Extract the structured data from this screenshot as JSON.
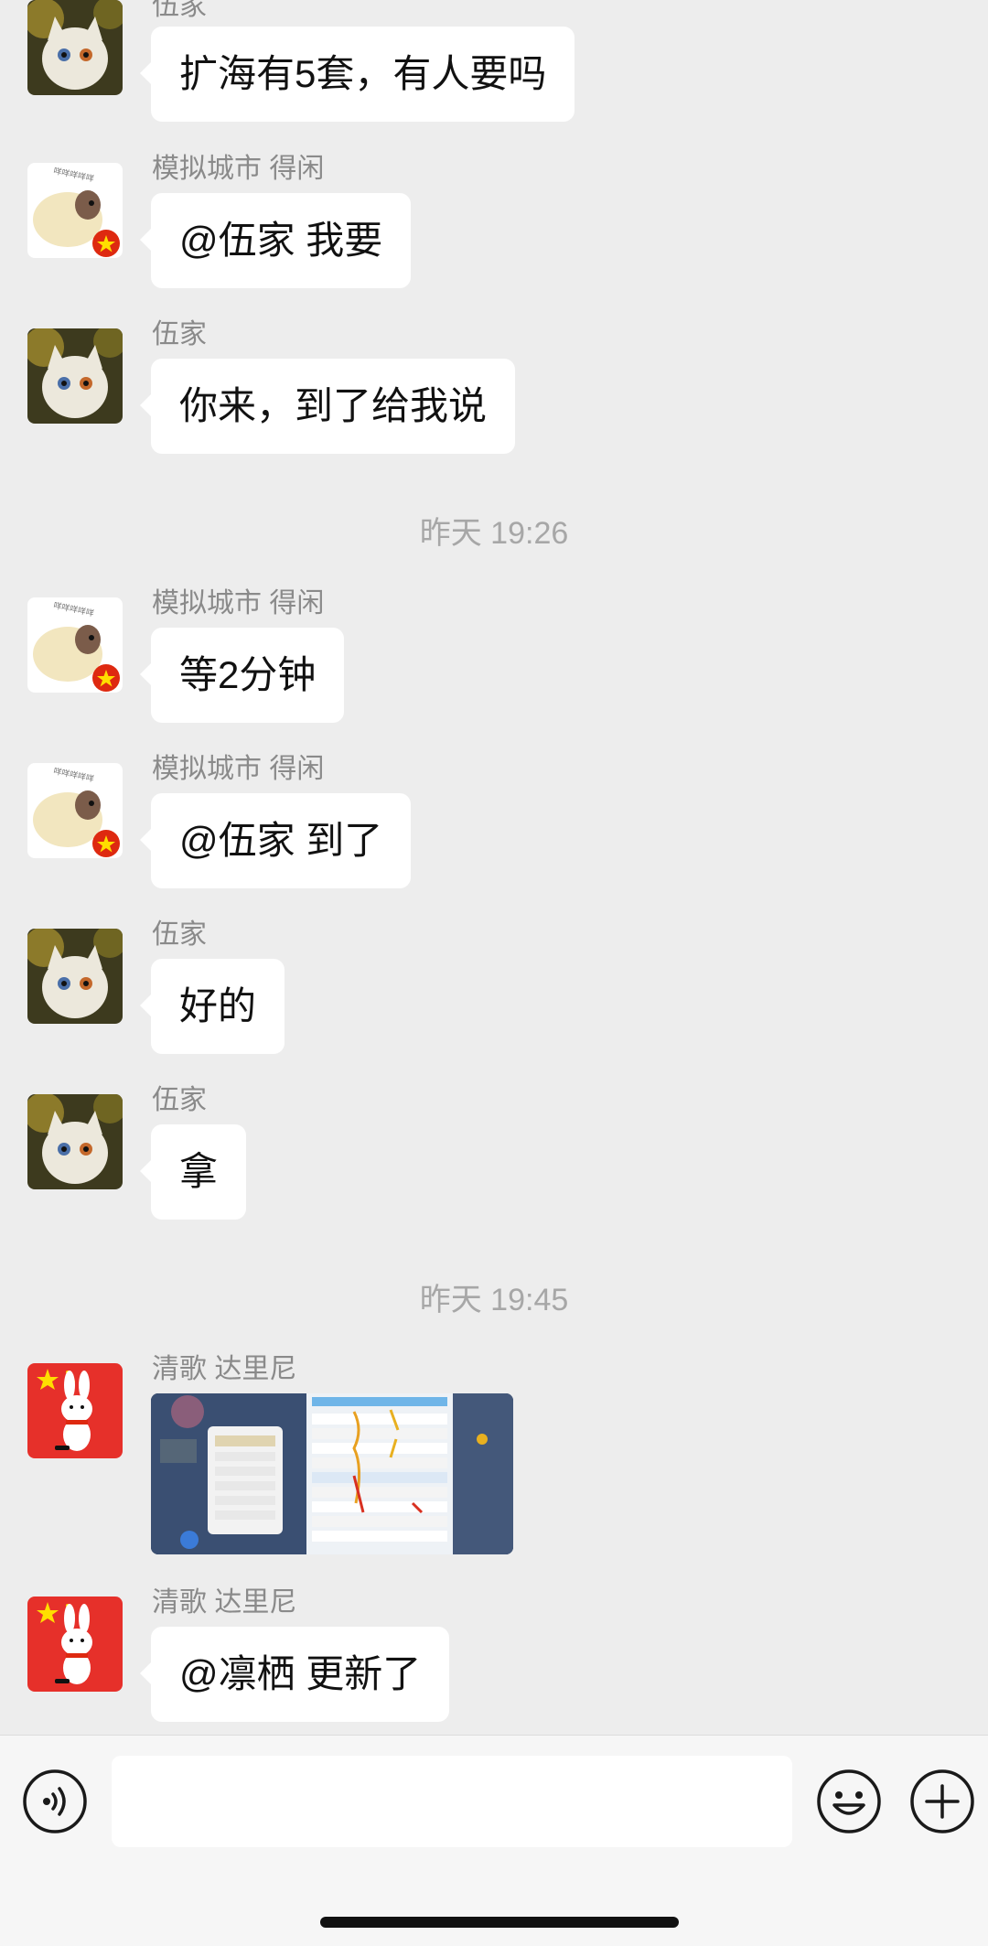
{
  "messages": [
    {
      "sender": "伍家",
      "text": "扩海有5套，有人要吗"
    },
    {
      "sender": "模拟城市  得闲",
      "text": "@伍家 我要"
    },
    {
      "sender": "伍家",
      "text": "你来，到了给我说"
    },
    {
      "time": "昨天 19:26"
    },
    {
      "sender": "模拟城市  得闲",
      "text": "等2分钟"
    },
    {
      "sender": "模拟城市  得闲",
      "text": "@伍家 到了"
    },
    {
      "sender": "伍家",
      "text": "好的"
    },
    {
      "sender": "伍家",
      "text": "拿"
    },
    {
      "time": "昨天 19:45"
    },
    {
      "sender": "清歌 达里尼",
      "image": "game-screenshot"
    },
    {
      "sender": "清歌 达里尼",
      "text": "@凛栖 更新了"
    }
  ],
  "input": {
    "value": ""
  },
  "icons": {
    "voice": "voice-icon",
    "emoji": "emoji-icon",
    "plus": "plus-icon"
  },
  "colors": {
    "background": "#ededed",
    "bubble": "#ffffff",
    "sender_text": "#8a8a8a",
    "time_text": "#a7a7a7",
    "avatar_red": "#e6302a"
  }
}
